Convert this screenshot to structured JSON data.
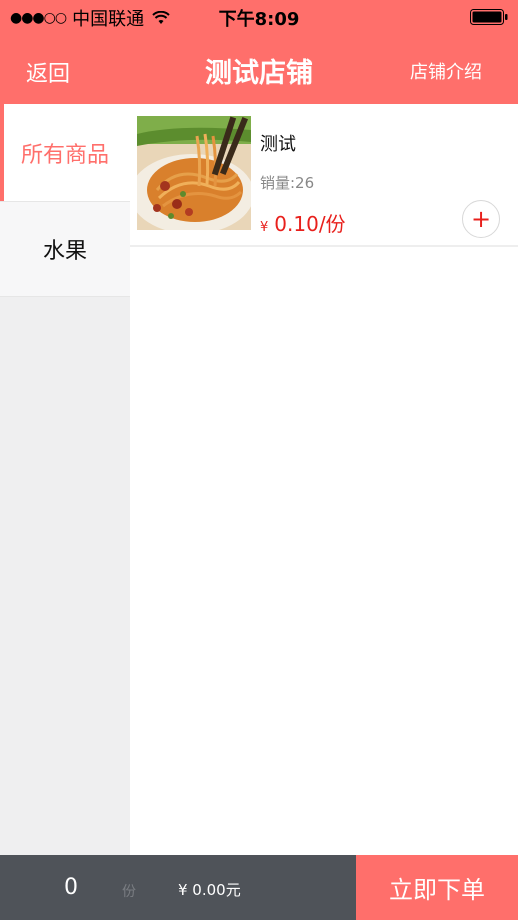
{
  "status_bar": {
    "carrier": "中国联通",
    "time": "下午8:09",
    "signal_icon": "signal-dots-icon",
    "wifi_icon": "wifi-icon",
    "battery_icon": "battery-icon"
  },
  "nav": {
    "back_label": "返回",
    "title": "测试店铺",
    "intro_label": "店铺介绍"
  },
  "sidebar": {
    "items": [
      {
        "label": "所有商品"
      },
      {
        "label": "水果"
      }
    ]
  },
  "products": [
    {
      "name": "测试",
      "sales": "销量:26",
      "currency": "¥",
      "price": "0.10/份",
      "add_label": "+",
      "image": "noodles-dish-image"
    }
  ],
  "cart": {
    "count": "0",
    "unit": "份",
    "total": "¥ 0.00元",
    "order_label": "立即下单"
  },
  "colors": {
    "accent": "#ff6f6b",
    "price": "#e8201c",
    "cart_bg": "#4f5359",
    "sidebar_bg": "#efeff0"
  }
}
